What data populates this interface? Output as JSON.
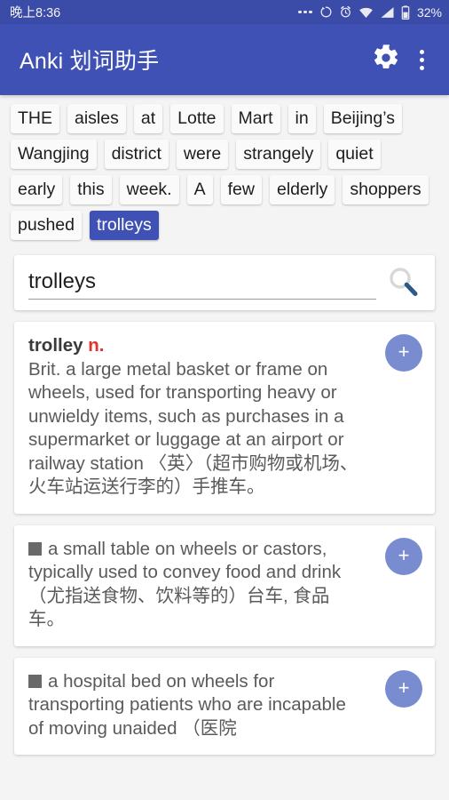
{
  "status_bar": {
    "time": "晚上8:36",
    "battery_percent": "32%",
    "icons": [
      "more-dots-icon",
      "sync-icon",
      "alarm-clock-icon",
      "wifi-icon",
      "cellular-signal-icon",
      "battery-icon"
    ],
    "background_color": "#3b4ba8"
  },
  "app_bar": {
    "title": "Anki 划词助手",
    "background_color": "#3f51b5",
    "actions": [
      {
        "name": "settings-gear",
        "icon": "gear-icon"
      },
      {
        "name": "overflow-menu",
        "icon": "more-vertical-icon"
      }
    ]
  },
  "word_chips": [
    {
      "text": "THE",
      "selected": false
    },
    {
      "text": "aisles",
      "selected": false
    },
    {
      "text": "at",
      "selected": false
    },
    {
      "text": "Lotte",
      "selected": false
    },
    {
      "text": "Mart",
      "selected": false
    },
    {
      "text": "in",
      "selected": false
    },
    {
      "text": "Beijing’s",
      "selected": false
    },
    {
      "text": "Wangjing",
      "selected": false
    },
    {
      "text": "district",
      "selected": false
    },
    {
      "text": "were",
      "selected": false
    },
    {
      "text": "strangely",
      "selected": false
    },
    {
      "text": "quiet",
      "selected": false
    },
    {
      "text": "early",
      "selected": false
    },
    {
      "text": "this",
      "selected": false
    },
    {
      "text": "week.",
      "selected": false
    },
    {
      "text": "A",
      "selected": false
    },
    {
      "text": "few",
      "selected": false
    },
    {
      "text": "elderly",
      "selected": false
    },
    {
      "text": "shoppers",
      "selected": false
    },
    {
      "text": "pushed",
      "selected": false
    },
    {
      "text": "trolleys",
      "selected": true
    }
  ],
  "search": {
    "value": "trolleys",
    "placeholder": "",
    "button_icon": "search-icon"
  },
  "definitions": [
    {
      "headword": "trolley",
      "part_of_speech": "n.",
      "has_marker": false,
      "body": "Brit. a large metal basket or frame on wheels, used for transporting heavy or unwieldy items, such as purchases in a supermarket or luggage at an airport or railway station 〈英〉（超市购物或机场、火车站运送行李的）手推车。",
      "add_label": "+"
    },
    {
      "headword": "",
      "part_of_speech": "",
      "has_marker": true,
      "body": "a small table on wheels or castors, typically used to convey food and drink （尤指送食物、饮料等的）台车, 食品车。",
      "add_label": "+"
    },
    {
      "headword": "",
      "part_of_speech": "",
      "has_marker": true,
      "body": "a hospital bed on wheels for transporting patients who are incapable of moving unaided （医院",
      "add_label": "+"
    }
  ],
  "colors": {
    "primary": "#3f51b5",
    "status_bar": "#3b4ba8",
    "page_background": "#f4f4f4",
    "card": "#ffffff",
    "accent_red": "#e2312a",
    "add_button": "#7a8cd0",
    "body_text": "#5a5a5a"
  }
}
